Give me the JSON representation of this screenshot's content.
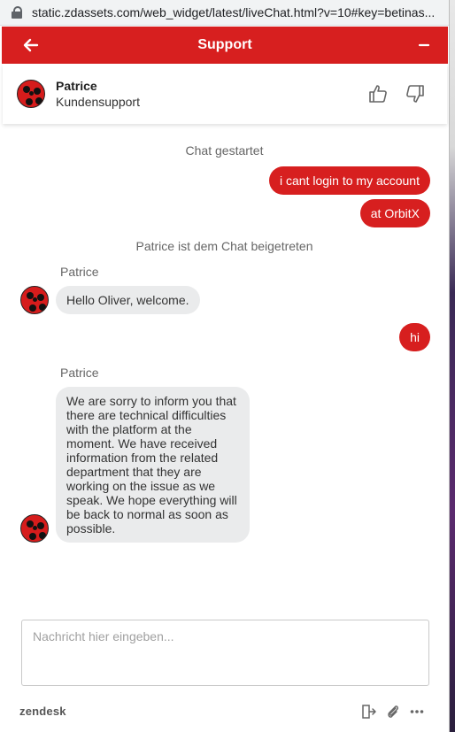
{
  "browser": {
    "url": "static.zdassets.com/web_widget/latest/liveChat.html?v=10#key=betinas..."
  },
  "header": {
    "title": "Support"
  },
  "agent": {
    "name": "Patrice",
    "role": "Kundensupport"
  },
  "messages": {
    "chat_started": "Chat gestartet",
    "out_1": "i cant login to my account",
    "out_2": "at OrbitX",
    "joined": "Patrice ist dem Chat beigetreten",
    "sender_1": "Patrice",
    "in_1": "Hello Oliver, welcome.",
    "out_3": "hi",
    "sender_2": "Patrice",
    "in_2": "We are sorry to inform you that there are technical difficulties with the platform at the moment. We have received information from the related department that they are working on the issue as we speak. We hope everything will be back to normal as soon as possible."
  },
  "composer": {
    "placeholder": "Nachricht hier eingeben..."
  },
  "footer": {
    "brand": "zendesk"
  },
  "colors": {
    "accent": "#d71f1f",
    "bubble_in": "#eaebec"
  },
  "icons": [
    "lock-icon",
    "back-arrow-icon",
    "minimize-icon",
    "thumbs-up-icon",
    "thumbs-down-icon",
    "end-chat-icon",
    "paperclip-icon",
    "more-options-icon"
  ]
}
